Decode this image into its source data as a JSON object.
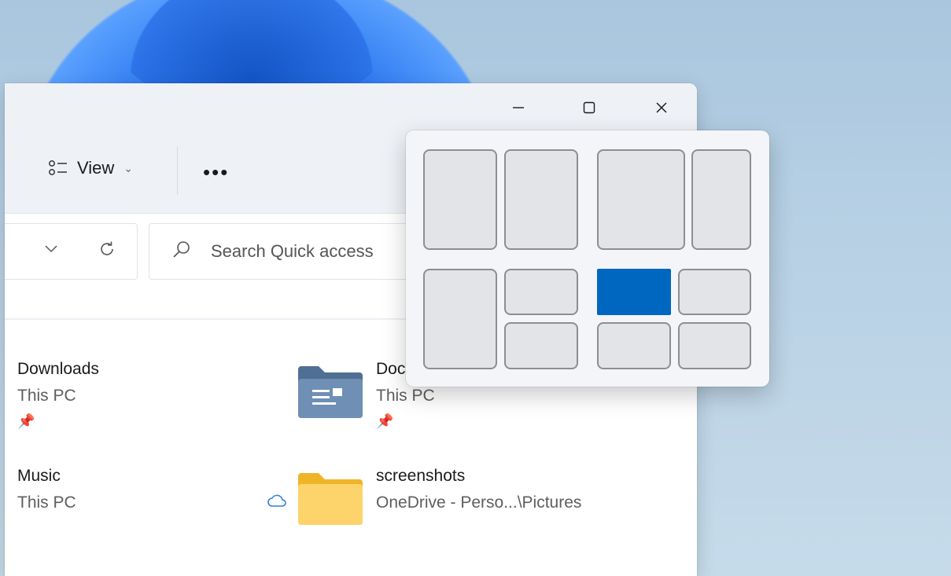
{
  "titlebar": {
    "minimize_label": "—",
    "maximize_label": "☐",
    "close_label": "✕"
  },
  "toolbar": {
    "view_label": "View",
    "more_label": "•••"
  },
  "search": {
    "placeholder": "Search Quick access"
  },
  "quick_access": [
    {
      "name": "Downloads",
      "location": "This PC",
      "pinned": true
    },
    {
      "name": "Doc",
      "location": "This PC",
      "pinned": true
    },
    {
      "name": "Music",
      "location": "This PC",
      "pinned": false
    },
    {
      "name": "screenshots",
      "location": "OneDrive - Perso...\\Pictures",
      "pinned": false,
      "cloud": true
    }
  ],
  "snap_layouts": {
    "active_zone": "layout-4-top-left"
  },
  "colors": {
    "accent": "#0067c0",
    "toolbar_bg": "#eef2f7"
  }
}
